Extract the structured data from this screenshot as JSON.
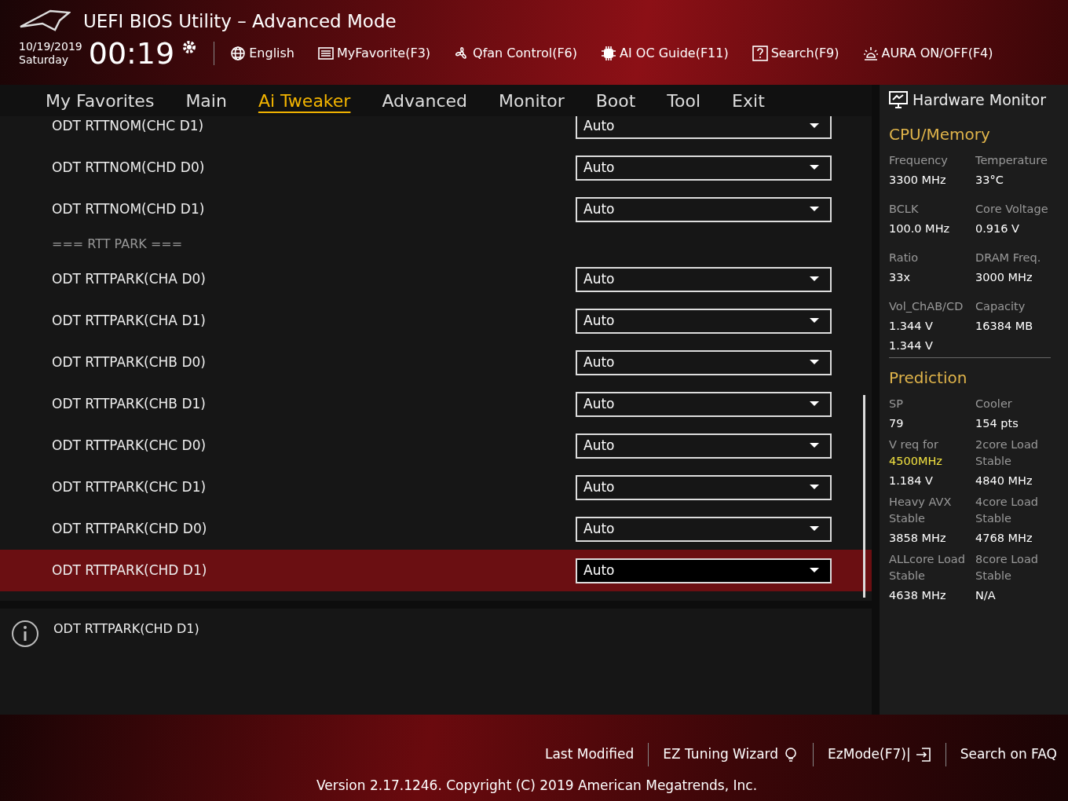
{
  "window": {
    "title": "UEFI BIOS Utility – Advanced Mode"
  },
  "clock": {
    "date": "10/19/2019",
    "day": "Saturday",
    "time": "00:19"
  },
  "toolbar": [
    {
      "label": "English"
    },
    {
      "label": "MyFavorite(F3)"
    },
    {
      "label": "Qfan Control(F6)"
    },
    {
      "label": "AI OC Guide(F11)"
    },
    {
      "label": "Search(F9)"
    },
    {
      "label": "AURA ON/OFF(F4)"
    }
  ],
  "tabs": [
    {
      "label": "My Favorites",
      "selected": false
    },
    {
      "label": "Main",
      "selected": false
    },
    {
      "label": "Ai Tweaker",
      "selected": true
    },
    {
      "label": "Advanced",
      "selected": false
    },
    {
      "label": "Monitor",
      "selected": false
    },
    {
      "label": "Boot",
      "selected": false
    },
    {
      "label": "Tool",
      "selected": false
    },
    {
      "label": "Exit",
      "selected": false
    }
  ],
  "settings": [
    {
      "kind": "setting",
      "label": "ODT RTTNOM(CHC D1)",
      "value": "Auto",
      "selected": false
    },
    {
      "kind": "setting",
      "label": "ODT RTTNOM(CHD D0)",
      "value": "Auto",
      "selected": false
    },
    {
      "kind": "setting",
      "label": "ODT RTTNOM(CHD D1)",
      "value": "Auto",
      "selected": false
    },
    {
      "kind": "header",
      "label": "=== RTT PARK ==="
    },
    {
      "kind": "setting",
      "label": "ODT RTTPARK(CHA D0)",
      "value": "Auto",
      "selected": false
    },
    {
      "kind": "setting",
      "label": "ODT RTTPARK(CHA D1)",
      "value": "Auto",
      "selected": false
    },
    {
      "kind": "setting",
      "label": "ODT RTTPARK(CHB D0)",
      "value": "Auto",
      "selected": false
    },
    {
      "kind": "setting",
      "label": "ODT RTTPARK(CHB D1)",
      "value": "Auto",
      "selected": false
    },
    {
      "kind": "setting",
      "label": "ODT RTTPARK(CHC D0)",
      "value": "Auto",
      "selected": false
    },
    {
      "kind": "setting",
      "label": "ODT RTTPARK(CHC D1)",
      "value": "Auto",
      "selected": false
    },
    {
      "kind": "setting",
      "label": "ODT RTTPARK(CHD D0)",
      "value": "Auto",
      "selected": false
    },
    {
      "kind": "setting",
      "label": "ODT RTTPARK(CHD D1)",
      "value": "Auto",
      "selected": true
    }
  ],
  "help": {
    "text": "ODT RTTPARK(CHD D1)"
  },
  "hardware_monitor": {
    "title": "Hardware Monitor",
    "sections": [
      {
        "title": "CPU/Memory",
        "cells": [
          {
            "label": "Frequency",
            "values": [
              "3300 MHz"
            ]
          },
          {
            "label": "Temperature",
            "values": [
              "33°C"
            ]
          },
          {
            "label": "BCLK",
            "values": [
              "100.0 MHz"
            ]
          },
          {
            "label": "Core Voltage",
            "values": [
              "0.916 V"
            ]
          },
          {
            "label": "Ratio",
            "values": [
              "33x"
            ]
          },
          {
            "label": "DRAM Freq.",
            "values": [
              "3000 MHz"
            ]
          },
          {
            "label": "Vol_ChAB/CD",
            "values": [
              "1.344 V",
              "1.344 V"
            ]
          },
          {
            "label": "Capacity",
            "values": [
              "16384 MB"
            ]
          }
        ]
      },
      {
        "title": "Prediction",
        "cells": [
          {
            "label": "SP",
            "values": [
              "79"
            ]
          },
          {
            "label": "Cooler",
            "values": [
              "154 pts"
            ]
          },
          {
            "label": "V req for",
            "highlight": "4500MHz",
            "values": [
              "1.184 V"
            ]
          },
          {
            "label": "2core Load Stable",
            "values": [
              "4840 MHz"
            ]
          },
          {
            "label": "Heavy AVX Stable",
            "values": [
              "3858 MHz"
            ]
          },
          {
            "label": "4core Load Stable",
            "values": [
              "4768 MHz"
            ]
          },
          {
            "label": "ALLcore Load Stable",
            "values": [
              "4638 MHz"
            ]
          },
          {
            "label": "8core Load Stable",
            "values": [
              "N/A"
            ]
          }
        ]
      }
    ]
  },
  "footer": {
    "links": [
      {
        "label": "Last Modified"
      },
      {
        "label": "EZ Tuning Wizard"
      },
      {
        "label": "EzMode(F7)|"
      },
      {
        "label": "Search on FAQ"
      }
    ],
    "version": "Version 2.17.1246. Copyright (C) 2019 American Megatrends, Inc."
  }
}
